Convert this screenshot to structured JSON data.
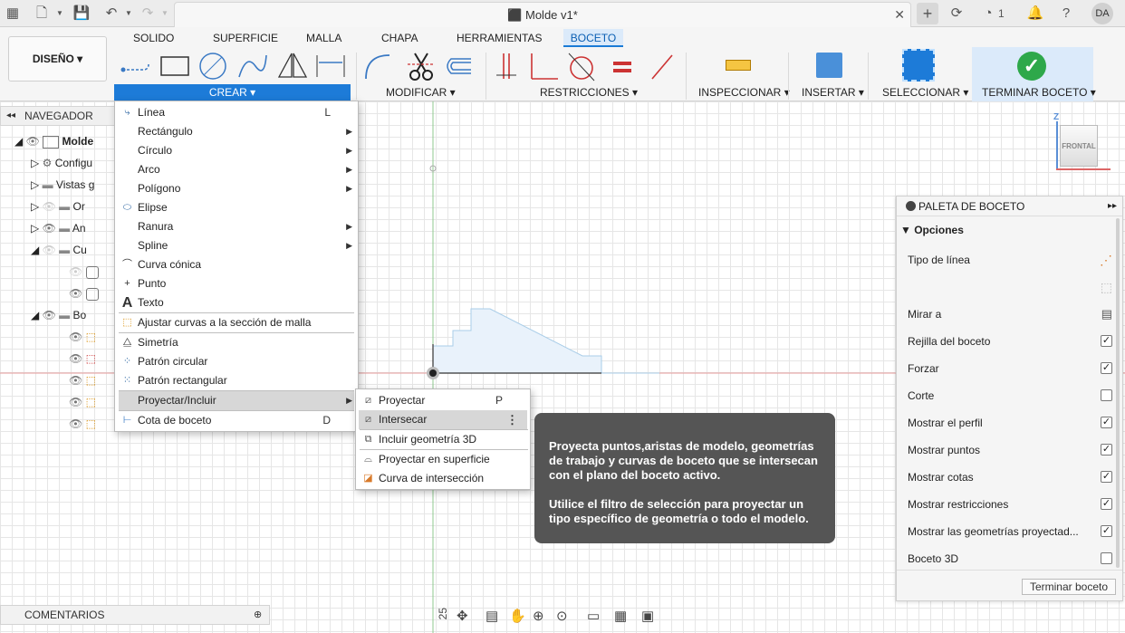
{
  "app": {
    "title": "Molde v1*",
    "user_initials": "DA",
    "notifications_count": "1"
  },
  "ribbon": {
    "tabs": [
      "SOLIDO",
      "SUPERFICIE",
      "MALLA",
      "CHAPA",
      "HERRAMIENTAS",
      "BOCETO"
    ],
    "active_tab": "BOCETO",
    "workspace": "DISEÑO",
    "groups": {
      "create": "CREAR",
      "modify": "MODIFICAR",
      "constraints": "RESTRICCIONES",
      "inspect": "INSPECCIONAR",
      "insert": "INSERTAR",
      "select": "SELECCIONAR",
      "finish": "TERMINAR BOCETO"
    }
  },
  "navigator": {
    "title": "NAVEGADOR",
    "rows": [
      "Molde",
      "Configu",
      "Vistas g",
      "Or",
      "An",
      "Cu",
      "Bo"
    ]
  },
  "create_menu": {
    "items": [
      {
        "label": "Línea",
        "shortcut": "L",
        "icon": "line-icon"
      },
      {
        "label": "Rectángulo",
        "submenu": true
      },
      {
        "label": "Círculo",
        "submenu": true
      },
      {
        "label": "Arco",
        "submenu": true
      },
      {
        "label": "Polígono",
        "submenu": true
      },
      {
        "label": "Elipse",
        "icon": "ellipse-icon"
      },
      {
        "label": "Ranura",
        "submenu": true
      },
      {
        "label": "Spline",
        "submenu": true
      },
      {
        "label": "Curva cónica",
        "icon": "conic-curve-icon"
      },
      {
        "label": "Punto",
        "icon": "point-icon"
      },
      {
        "label": "Texto",
        "icon": "text-icon"
      },
      {
        "label": "Ajustar curvas a la sección de malla",
        "icon": "fit-curves-icon"
      },
      {
        "label": "Simetría",
        "icon": "mirror-icon"
      },
      {
        "label": "Patrón circular",
        "icon": "circular-pattern-icon"
      },
      {
        "label": "Patrón rectangular",
        "icon": "rectangular-pattern-icon"
      },
      {
        "label": "Proyectar/Incluir",
        "submenu": true
      },
      {
        "label": "Cota de boceto",
        "shortcut": "D",
        "icon": "sketch-dimension-icon"
      }
    ]
  },
  "project_submenu": {
    "items": [
      {
        "label": "Proyectar",
        "shortcut": "P"
      },
      {
        "label": "Intersecar"
      },
      {
        "label": "Incluir geometría 3D"
      },
      {
        "label": "Proyectar en superficie"
      },
      {
        "label": "Curva de intersección"
      }
    ]
  },
  "tooltip": {
    "p1": "Proyecta puntos,aristas de modelo, geometrías de trabajo y curvas de boceto que se intersecan con el plano del boceto activo.",
    "p2": "Utilice el filtro de selección para proyectar un tipo específico de geometría o todo el modelo."
  },
  "palette": {
    "title": "PALETA DE BOCETO",
    "section": "Opciones",
    "line_type_label": "Tipo de línea",
    "look_at_label": "Mirar a",
    "options": [
      {
        "label": "Rejilla del boceto",
        "checked": true
      },
      {
        "label": "Forzar",
        "checked": true
      },
      {
        "label": "Corte",
        "checked": false
      },
      {
        "label": "Mostrar el perfil",
        "checked": true
      },
      {
        "label": "Mostrar puntos",
        "checked": true
      },
      {
        "label": "Mostrar cotas",
        "checked": true
      },
      {
        "label": "Mostrar restricciones",
        "checked": true
      },
      {
        "label": "Mostrar las geometrías proyectad...",
        "checked": true
      },
      {
        "label": "Boceto 3D",
        "checked": false
      }
    ],
    "finish_button": "Terminar boceto"
  },
  "comments": {
    "label": "COMENTARIOS"
  },
  "viewcube": {
    "face": "FRONTAL",
    "axis": "Z"
  },
  "scale_label": "25"
}
